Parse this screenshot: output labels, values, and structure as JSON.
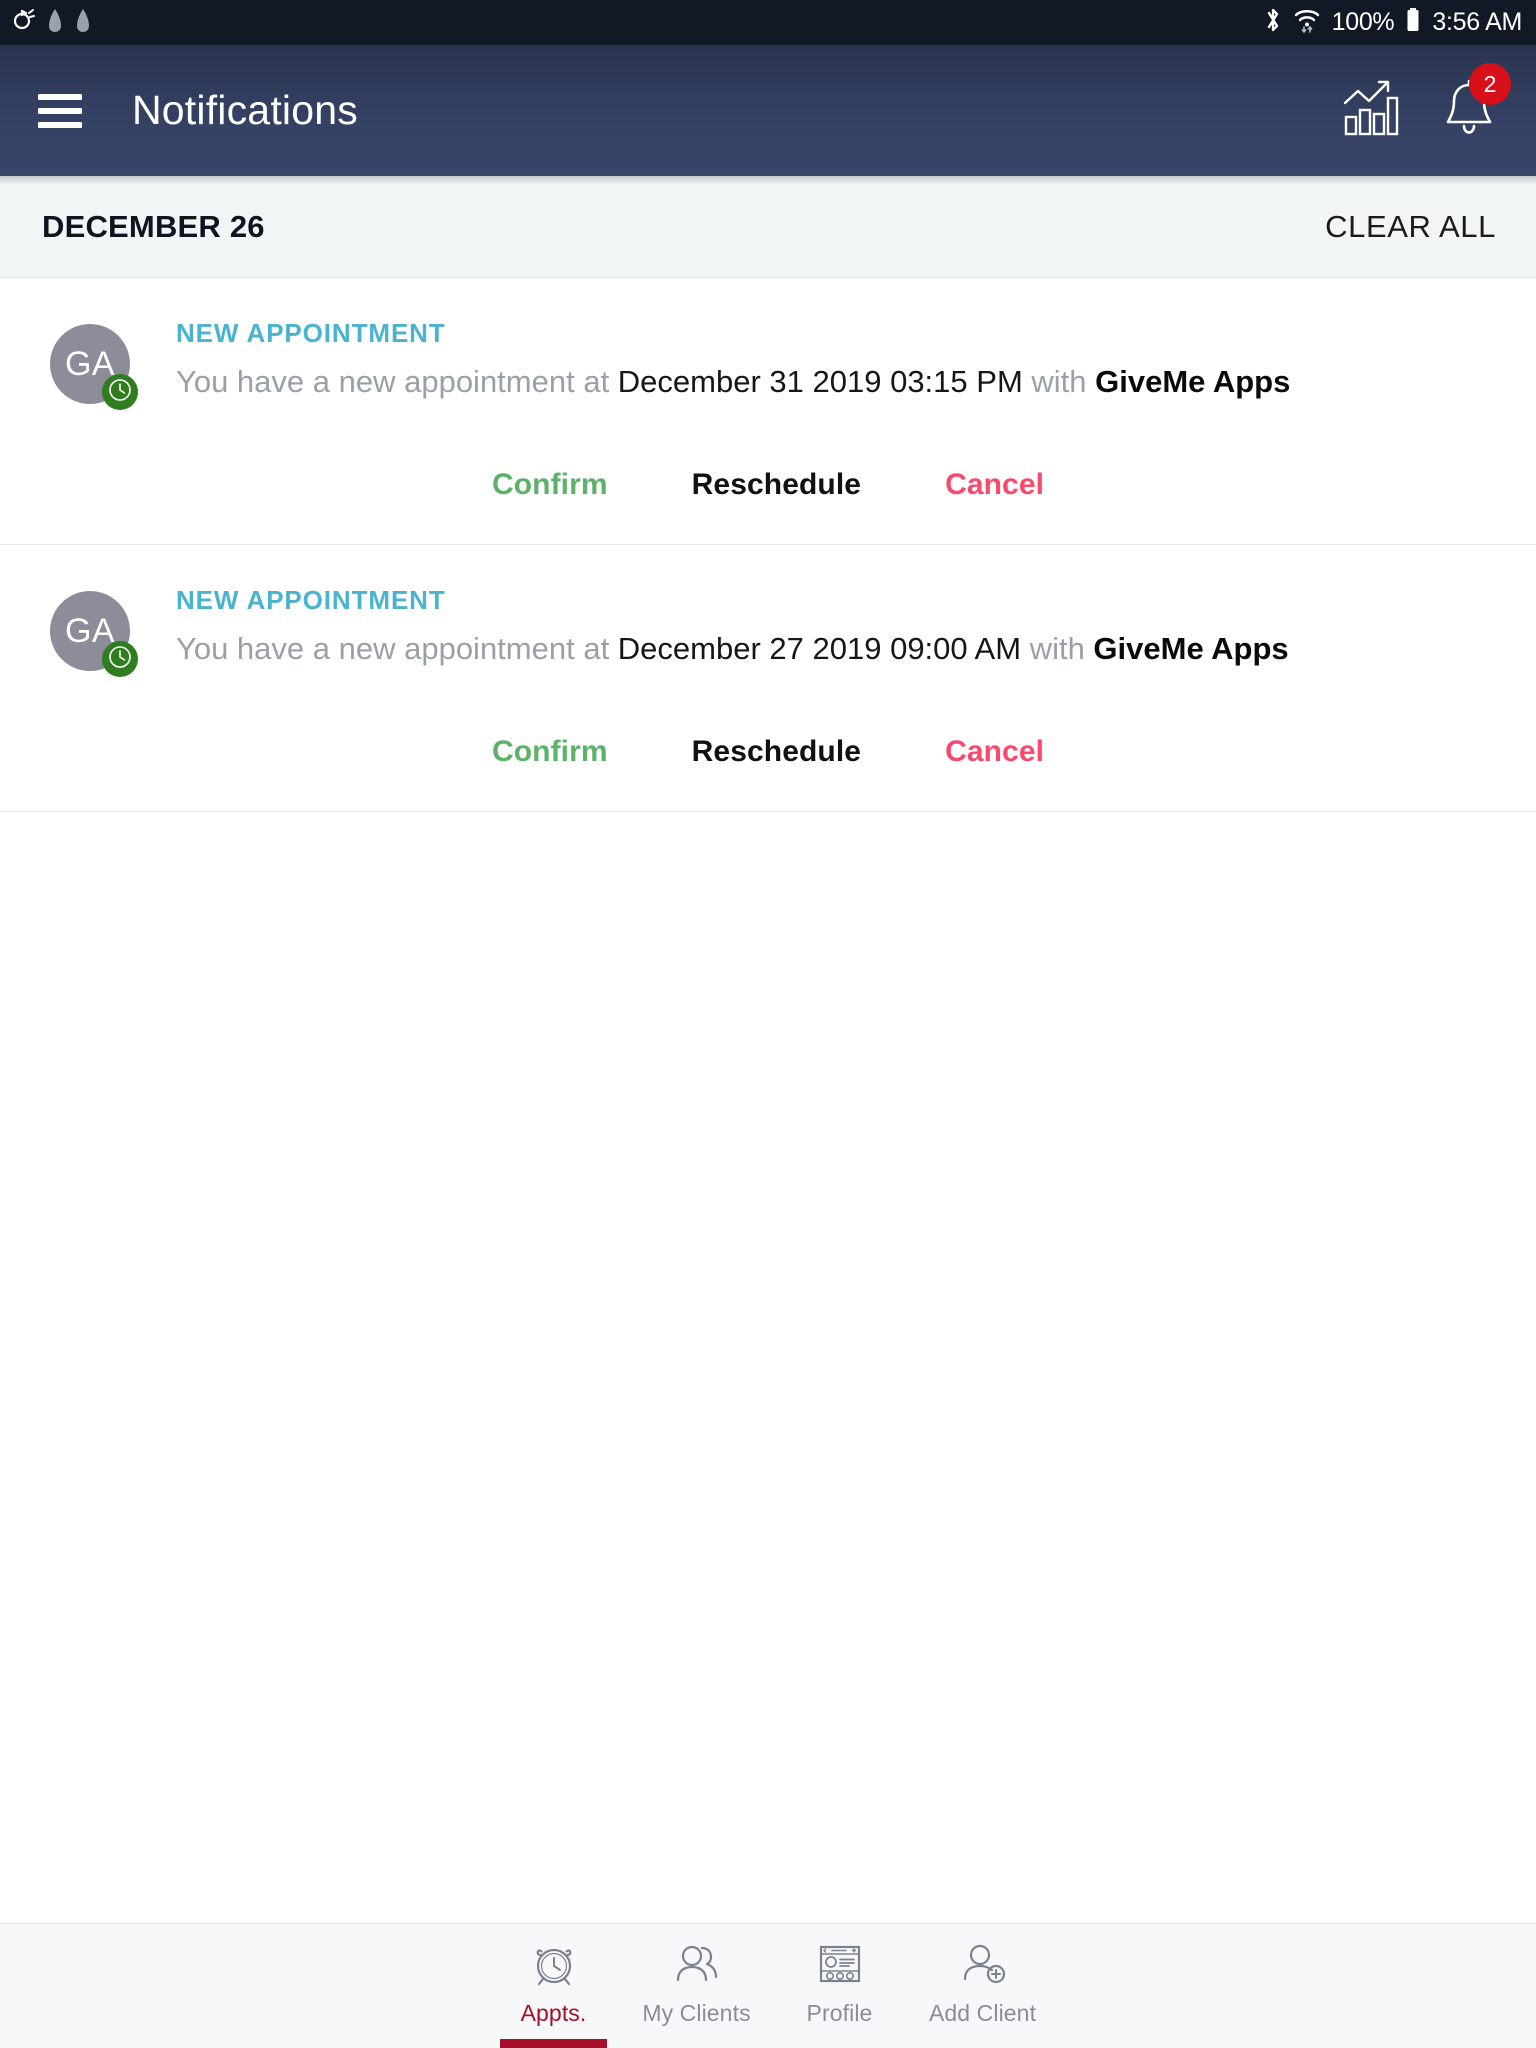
{
  "status_bar": {
    "left_icons": [
      "screen-rotation-icon",
      "home-upload-icon",
      "home-upload-icon-2"
    ],
    "bluetooth_icon": "bluetooth-icon",
    "wifi_icon": "wifi-icon",
    "battery_percent": "100%",
    "battery_icon": "battery-full-icon",
    "time": "3:56 AM"
  },
  "app_bar": {
    "menu_icon": "hamburger-menu-icon",
    "title": "Notifications",
    "stats_icon": "bar-chart-icon",
    "bell_icon": "bell-icon",
    "bell_badge": "2",
    "badge_color": "#d7101a",
    "background_color": "#344163"
  },
  "section": {
    "date": "DECEMBER 26",
    "clear_all_label": "CLEAR ALL"
  },
  "notifications": [
    {
      "avatar_initials": "GA",
      "avatar_color": "#8d8c99",
      "badge_icon": "clock-icon",
      "badge_color": "#2f7d1f",
      "kind": "NEW APPOINTMENT",
      "kind_color": "#4ab3cf",
      "text_prefix": "You have a new appointment at ",
      "datetime": "December 31 2019 03:15 PM",
      "text_join": " with ",
      "party": "GiveMe Apps",
      "actions": {
        "confirm": "Confirm",
        "reschedule": "Reschedule",
        "cancel": "Cancel"
      }
    },
    {
      "avatar_initials": "GA",
      "avatar_color": "#8d8c99",
      "badge_icon": "clock-icon",
      "badge_color": "#2f7d1f",
      "kind": "NEW APPOINTMENT",
      "kind_color": "#4ab3cf",
      "text_prefix": "You have a new appointment at ",
      "datetime": "December 27 2019 09:00 AM",
      "text_join": " with ",
      "party": "GiveMe Apps",
      "actions": {
        "confirm": "Confirm",
        "reschedule": "Reschedule",
        "cancel": "Cancel"
      }
    }
  ],
  "bottom_nav": {
    "active_color": "#a50f2a",
    "inactive_color": "#8a8d93",
    "items": [
      {
        "label": "Appts.",
        "icon": "alarm-clock-icon",
        "active": true
      },
      {
        "label": "My Clients",
        "icon": "people-icon",
        "active": false
      },
      {
        "label": "Profile",
        "icon": "profile-card-icon",
        "active": false
      },
      {
        "label": "Add Client",
        "icon": "person-add-icon",
        "active": false
      }
    ]
  }
}
